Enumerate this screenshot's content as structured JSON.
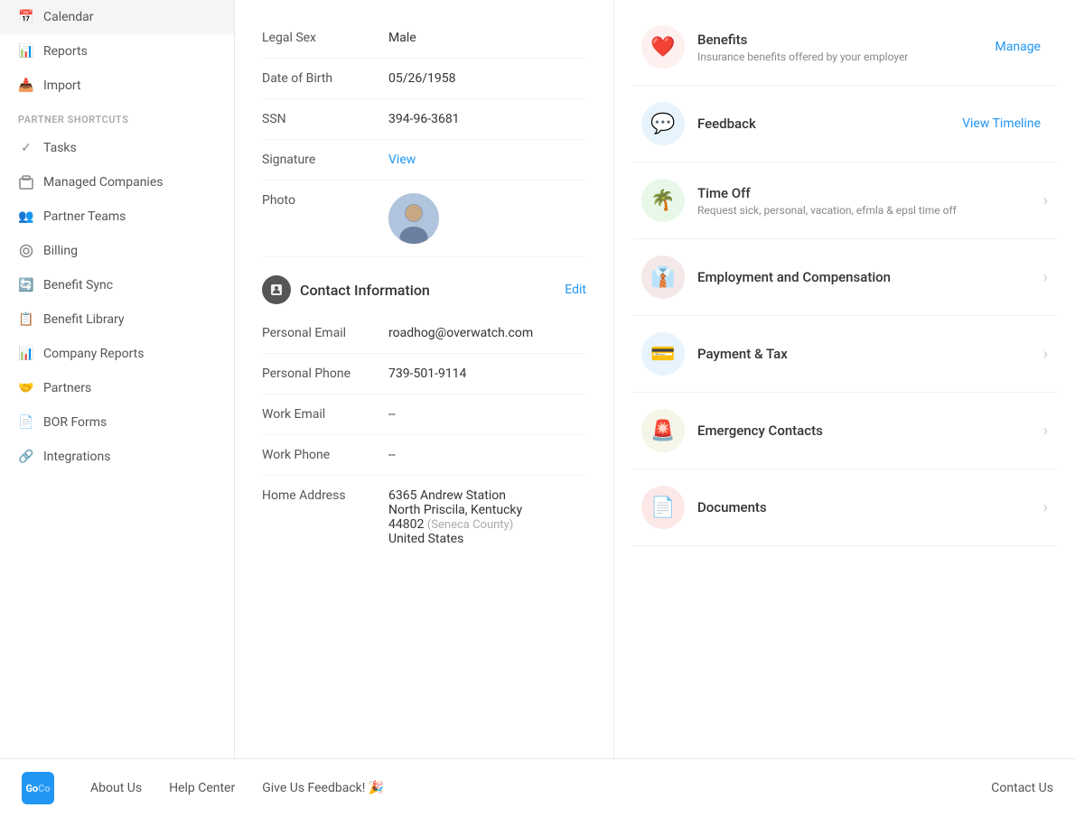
{
  "sidebar": {
    "partner_shortcuts_label": "PARTNER SHORTCUTS",
    "items": [
      {
        "label": "Calendar",
        "icon": "📅",
        "name": "calendar"
      },
      {
        "label": "Reports",
        "icon": "📊",
        "name": "reports"
      },
      {
        "label": "Import",
        "icon": "📥",
        "name": "import"
      },
      {
        "label": "Tasks",
        "icon": "✓",
        "name": "tasks"
      },
      {
        "label": "Managed Companies",
        "icon": "🏢",
        "name": "managed-companies"
      },
      {
        "label": "Partner Teams",
        "icon": "👥",
        "name": "partner-teams"
      },
      {
        "label": "Billing",
        "icon": "⊙",
        "name": "billing"
      },
      {
        "label": "Benefit Sync",
        "icon": "🔄",
        "name": "benefit-sync"
      },
      {
        "label": "Benefit Library",
        "icon": "📋",
        "name": "benefit-library"
      },
      {
        "label": "Company Reports",
        "icon": "📊",
        "name": "company-reports"
      },
      {
        "label": "Partners",
        "icon": "🤝",
        "name": "partners"
      },
      {
        "label": "BOR Forms",
        "icon": "📄",
        "name": "bor-forms"
      },
      {
        "label": "Integrations",
        "icon": "🔗",
        "name": "integrations"
      }
    ]
  },
  "personal_info": {
    "fields": [
      {
        "label": "Legal Sex",
        "value": "Male"
      },
      {
        "label": "Date of Birth",
        "value": "05/26/1958"
      },
      {
        "label": "SSN",
        "value": "394-96-3681"
      },
      {
        "label": "Signature",
        "value": "View",
        "is_link": true
      },
      {
        "label": "Photo",
        "value": "",
        "is_photo": true
      }
    ]
  },
  "contact_info": {
    "section_title": "Contact Information",
    "edit_label": "Edit",
    "fields": [
      {
        "label": "Personal Email",
        "value": "roadhog@overwatch.com"
      },
      {
        "label": "Personal Phone",
        "value": "739-501-9114"
      },
      {
        "label": "Work Email",
        "value": "--"
      },
      {
        "label": "Work Phone",
        "value": "--"
      },
      {
        "label": "Home Address",
        "value": "6365 Andrew Station",
        "line2": "North Priscila, Kentucky",
        "line3": "44802",
        "county": "(Seneca County)",
        "line4": "United States"
      }
    ]
  },
  "cards": [
    {
      "title": "Benefits",
      "subtitle": "Insurance benefits offered by your employer",
      "action": "Manage",
      "has_chevron": false,
      "icon": "❤️",
      "icon_bg": "icon-benefits"
    },
    {
      "title": "Feedback",
      "subtitle": "",
      "action": "View Timeline",
      "has_chevron": false,
      "icon": "💬",
      "icon_bg": "icon-feedback"
    },
    {
      "title": "Time Off",
      "subtitle": "Request sick, personal, vacation, efmla & epsl time off",
      "action": "",
      "has_chevron": true,
      "icon": "🌴",
      "icon_bg": "icon-timeoff"
    },
    {
      "title": "Employment and Compensation",
      "subtitle": "",
      "action": "",
      "has_chevron": true,
      "icon": "👔",
      "icon_bg": "icon-employment"
    },
    {
      "title": "Payment & Tax",
      "subtitle": "",
      "action": "",
      "has_chevron": true,
      "icon": "💳",
      "icon_bg": "icon-payment"
    },
    {
      "title": "Emergency Contacts",
      "subtitle": "",
      "action": "",
      "has_chevron": true,
      "icon": "🚨",
      "icon_bg": "icon-emergency"
    },
    {
      "title": "Documents",
      "subtitle": "",
      "action": "",
      "has_chevron": true,
      "icon": "📄",
      "icon_bg": "icon-documents"
    }
  ],
  "footer": {
    "logo_text": "GoCo",
    "links": [
      "About Us",
      "Help Center",
      "Give Us Feedback! 🎉"
    ],
    "contact_us": "Contact Us"
  }
}
